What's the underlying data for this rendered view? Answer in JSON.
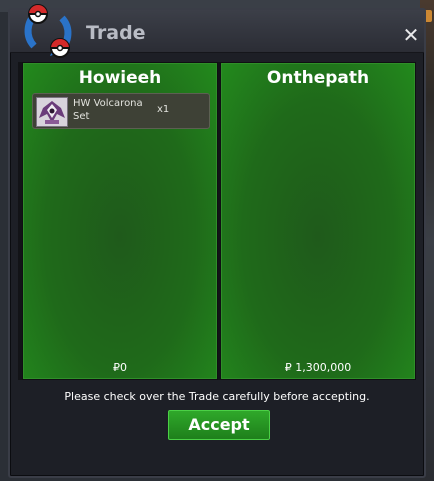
{
  "window": {
    "title": "Trade",
    "close_symbol": "✕"
  },
  "panels": {
    "left": {
      "name": "Howieeh",
      "items": [
        {
          "name": "HW Volcarona Set",
          "quantity": "x1",
          "icon": "volcarona-set-icon"
        }
      ],
      "money_symbol": "₽",
      "money": "0"
    },
    "right": {
      "name": "Onthepath",
      "items": [],
      "money_symbol": "₽",
      "money": "1,300,000"
    }
  },
  "footer": {
    "notice": "Please check over the Trade carefully before accepting.",
    "accept_label": "Accept"
  },
  "colors": {
    "panel_green": "#1f6a1a",
    "accept_green": "#2fa82a",
    "window_bg": "#1d1f26"
  }
}
